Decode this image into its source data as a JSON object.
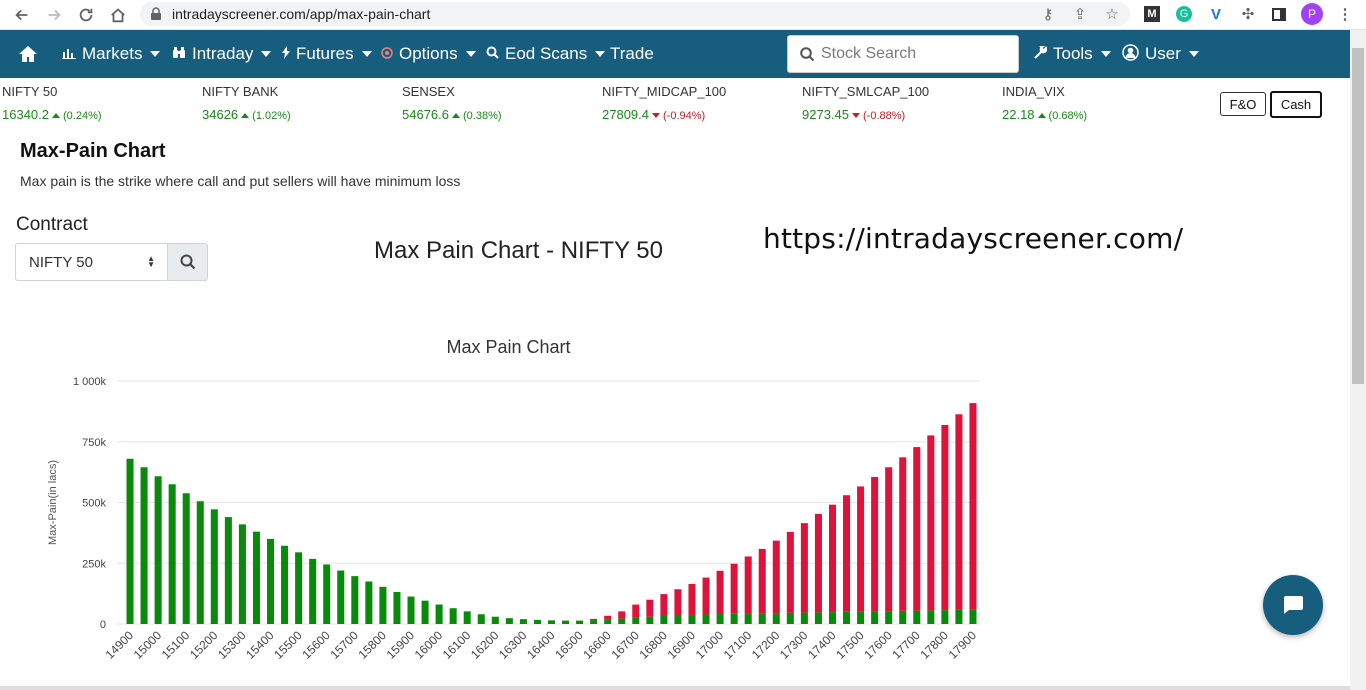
{
  "browser": {
    "url": "intradayscreener.com/app/max-pain-chart",
    "avatar_letter": "P"
  },
  "navbar": {
    "items": [
      {
        "label": "Markets",
        "icon": "bar-chart-icon"
      },
      {
        "label": "Intraday",
        "icon": "binoculars-icon"
      },
      {
        "label": "Futures",
        "icon": "bolt-icon"
      },
      {
        "label": "Options",
        "icon": "target-icon"
      },
      {
        "label": "Eod Scans",
        "icon": "search-icon"
      },
      {
        "label": "Trade",
        "icon": ""
      }
    ],
    "search_placeholder": "Stock Search",
    "tools_label": "Tools",
    "user_label": "User"
  },
  "ticker": [
    {
      "name": "NIFTY 50",
      "price": "16340.2",
      "change": "(0.24%)",
      "dir": "up"
    },
    {
      "name": "NIFTY BANK",
      "price": "34626",
      "change": "(1.02%)",
      "dir": "up"
    },
    {
      "name": "SENSEX",
      "price": "54676.6",
      "change": "(0.38%)",
      "dir": "up"
    },
    {
      "name": "NIFTY_MIDCAP_100",
      "price": "27809.4",
      "change": "(-0.94%)",
      "dir": "down"
    },
    {
      "name": "NIFTY_SMLCAP_100",
      "price": "9273.45",
      "change": "(-0.88%)",
      "dir": "down"
    },
    {
      "name": "INDIA_VIX",
      "price": "22.18",
      "change": "(0.68%)",
      "dir": "up"
    }
  ],
  "segment": {
    "fo_label": "F&O",
    "cash_label": "Cash",
    "active": "Cash"
  },
  "page": {
    "title": "Max-Pain Chart",
    "subtitle": "Max pain is the strike where call and put sellers will have minimum loss",
    "contract_label": "Contract",
    "contract_value": "NIFTY 50",
    "chart_heading": "Max Pain Chart - NIFTY 50",
    "site_url": "https://intradayscreener.com/"
  },
  "colors": {
    "navbar": "#175d7e",
    "green_bar": "#0a8a0a",
    "red_bar": "#dc143c",
    "up": "#1a8a1a",
    "down": "#c0202a"
  },
  "chart_data": {
    "type": "bar",
    "title": "Max Pain Chart",
    "ylabel": "Max-Pain(in lacs)",
    "xlabel": "",
    "ylim": [
      0,
      1000000
    ],
    "yticks": [
      {
        "value": 0,
        "label": "0"
      },
      {
        "value": 250000,
        "label": "250k"
      },
      {
        "value": 500000,
        "label": "500k"
      },
      {
        "value": 750000,
        "label": "750k"
      },
      {
        "value": 1000000,
        "label": "1 000k"
      }
    ],
    "grid": true,
    "categories": [
      14900,
      14950,
      15000,
      15050,
      15100,
      15150,
      15200,
      15250,
      15300,
      15350,
      15400,
      15450,
      15500,
      15550,
      15600,
      15650,
      15700,
      15750,
      15800,
      15850,
      15900,
      15950,
      16000,
      16050,
      16100,
      16150,
      16200,
      16250,
      16300,
      16350,
      16400,
      16450,
      16500,
      16550,
      16600,
      16650,
      16700,
      16750,
      16800,
      16850,
      16900,
      16950,
      17000,
      17050,
      17100,
      17150,
      17200,
      17250,
      17300,
      17350,
      17400,
      17450,
      17500,
      17550,
      17600,
      17650,
      17700,
      17750,
      17800,
      17850,
      17900
    ],
    "tick_labels": [
      "14900",
      "15000",
      "15100",
      "15200",
      "15300",
      "15400",
      "15500",
      "15600",
      "15700",
      "15800",
      "15900",
      "16000",
      "16100",
      "16200",
      "16300",
      "16400",
      "16500",
      "16600",
      "16700",
      "16800",
      "16900",
      "17000",
      "17100",
      "17200",
      "17300",
      "17400",
      "17500",
      "17600",
      "17700",
      "17800",
      "17900"
    ],
    "series": [
      {
        "color": "green",
        "values": [
          680000,
          645000,
          608000,
          575000,
          538000,
          505000,
          472000,
          440000,
          410000,
          380000,
          350000,
          322000,
          295000,
          268000,
          245000,
          220000,
          197000,
          175000,
          153000,
          132000,
          113000,
          96000,
          80000,
          65000,
          52000,
          40000,
          30000,
          24000,
          20000,
          17000,
          15000,
          14000,
          14000,
          16000,
          19000,
          22000,
          25000,
          30000,
          33000,
          35000,
          37000,
          39000,
          41000,
          42000,
          43000,
          44000,
          45000,
          46000,
          47000,
          48000,
          49000,
          50000,
          51000,
          52000,
          53000,
          54000,
          55000,
          56000,
          57000,
          58000,
          59000
        ]
      },
      {
        "color": "red",
        "values": [
          0,
          0,
          0,
          0,
          0,
          0,
          0,
          0,
          0,
          0,
          0,
          0,
          0,
          0,
          0,
          0,
          0,
          0,
          0,
          0,
          0,
          0,
          0,
          0,
          0,
          0,
          0,
          0,
          0,
          0,
          0,
          0,
          0,
          5000,
          15000,
          30000,
          55000,
          70000,
          90000,
          108000,
          128000,
          152000,
          178000,
          206000,
          235000,
          265000,
          298000,
          333000,
          368000,
          405000,
          442000,
          480000,
          515000,
          553000,
          592000,
          632000,
          673000,
          720000,
          762000,
          805000,
          850000
        ]
      }
    ]
  }
}
